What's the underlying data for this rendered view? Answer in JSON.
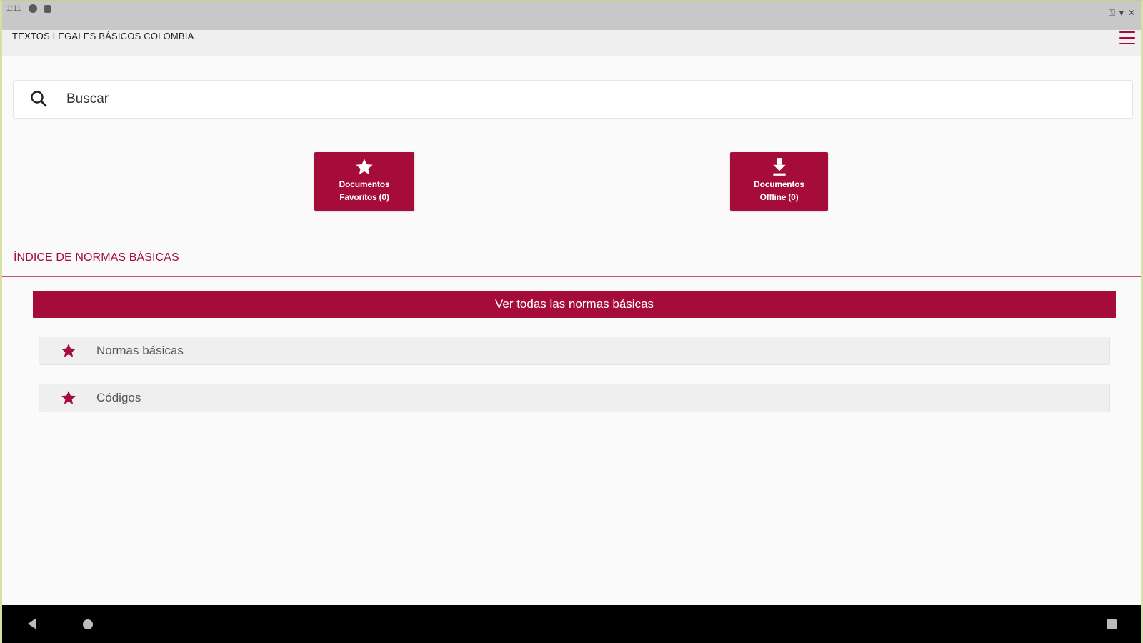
{
  "status_bar": {
    "time": "1:11"
  },
  "app_bar": {
    "title": "TEXTOS LEGALES BÁSICOS COLOMBIA"
  },
  "search": {
    "placeholder": "Buscar"
  },
  "quick_buttons": {
    "favorites": {
      "line1": "Documentos",
      "line2": "Favoritos (0)",
      "icon": "star-icon"
    },
    "offline": {
      "line1": "Documentos",
      "line2": "Offline (0)",
      "icon": "download-icon"
    }
  },
  "section": {
    "title": "ÍNDICE DE NORMAS BÁSICAS"
  },
  "view_all": {
    "label": "Ver todas las normas básicas"
  },
  "list": [
    {
      "label": "Normas básicas",
      "icon": "star-icon"
    },
    {
      "label": "Códigos",
      "icon": "star-icon"
    }
  ],
  "colors": {
    "accent": "#a50c3a",
    "background": "#fafafa",
    "list_bg": "#efefef"
  }
}
